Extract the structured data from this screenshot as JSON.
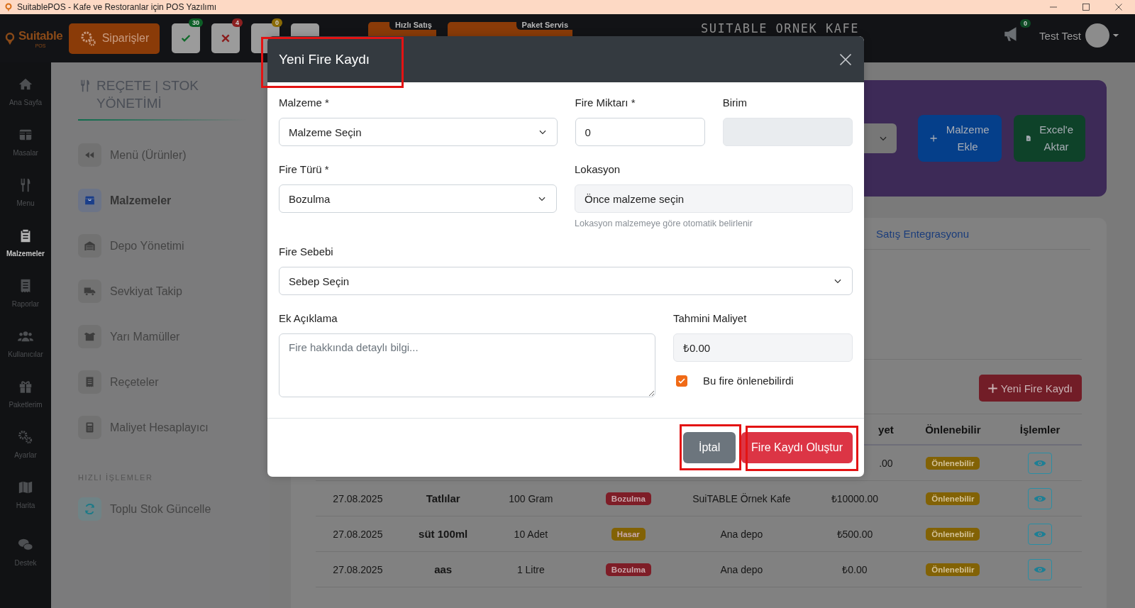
{
  "window": {
    "title": "SuitablePOS - Kafe ve Restoranlar için POS Yazılımı"
  },
  "top_bar": {
    "logo": "Suitable",
    "logo_sub": "POS",
    "orders_button": "Siparişler",
    "status_buttons": [
      {
        "kind": "check",
        "count": "30",
        "color": "#0d5f27"
      },
      {
        "kind": "cross",
        "count": "4",
        "color": "#8c2020"
      },
      {
        "kind": "blank",
        "count": "0",
        "color": "#8a6a05"
      },
      {
        "kind": "blank"
      }
    ],
    "quick_buttons": [
      {
        "label": "Hızlı Satış"
      },
      {
        "label": "Paket Servis"
      }
    ],
    "store_name": "SUITABLE ORNEK KAFE",
    "announcement_count": "0",
    "user": "Test Test"
  },
  "rail": [
    {
      "label": "Ana Sayfa",
      "selected": false
    },
    {
      "label": "Masalar",
      "selected": false
    },
    {
      "label": "Menu",
      "selected": false
    },
    {
      "label": "Malzemeler",
      "selected": true
    },
    {
      "label": "Raporlar",
      "selected": false
    },
    {
      "label": "Kullanıcılar",
      "selected": false
    },
    {
      "label": "Paketlerim",
      "selected": false
    },
    {
      "label": "Ayarlar",
      "selected": false
    },
    {
      "label": "Harita",
      "selected": false
    },
    {
      "label": "Destek",
      "selected": false
    }
  ],
  "stock_menu": {
    "title": "REÇETE | STOK YÖNETİMİ",
    "items": [
      {
        "label": "Menü (Ürünler)",
        "selected": false
      },
      {
        "label": "Malzemeler",
        "selected": true
      },
      {
        "label": "Depo Yönetimi",
        "selected": false
      },
      {
        "label": "Sevkiyat Takip",
        "selected": false
      },
      {
        "label": "Yarı Mamüller",
        "selected": false
      },
      {
        "label": "Reçeteler",
        "selected": false
      },
      {
        "label": "Maliyet Hesaplayıcı",
        "selected": false
      }
    ],
    "section_title": "HIZLI İŞLEMLER",
    "quick_actions": [
      {
        "label": "Toplu Stok Güncelle"
      }
    ]
  },
  "header_card": {
    "buttons": [
      {
        "kind": "add",
        "label": "Malzeme Ekle"
      },
      {
        "kind": "excel",
        "label": "Excel'e Aktar"
      }
    ]
  },
  "tabs": [
    {
      "label": "Satış Entegrasyonu"
    }
  ],
  "new_waste_button": "Yeni Fire Kaydı",
  "table": {
    "columns": [
      "yet",
      "Önlenebilir",
      "İşlemler"
    ],
    "rows": [
      {
        "cost": ".00",
        "preventable": "Önlenebilir"
      },
      {
        "date": "27.08.2025",
        "item": "Tatlılar",
        "quantity": "100 Gram",
        "type": {
          "label": "Bozulma",
          "color": "#7e1d27"
        },
        "location": "SuiTABLE Örnek Kafe",
        "cost": "₺10000.00",
        "preventable": "Önlenebilir"
      },
      {
        "date": "27.08.2025",
        "item": "süt 100ml",
        "quantity": "10 Adet",
        "type": {
          "label": "Hasar",
          "color": "#826205"
        },
        "location": "Ana depo",
        "cost": "₺500.00",
        "preventable": "Önlenebilir"
      },
      {
        "date": "27.08.2025",
        "item": "aas",
        "quantity": "1 Litre",
        "type": {
          "label": "Bozulma",
          "color": "#7e1d27"
        },
        "location": "Ana depo",
        "cost": "₺0.00",
        "preventable": "Önlenebilir"
      }
    ]
  },
  "modal": {
    "title": "Yeni Fire Kaydı",
    "rows": [
      [
        {
          "label": "Malzeme *",
          "kind": "select",
          "value": "Malzeme Seçin"
        },
        {
          "label": "Fire Miktarı *",
          "kind": "input",
          "value": "0"
        },
        {
          "label": "Birim",
          "kind": "readonly"
        }
      ],
      [
        {
          "label": "Fire Türü *",
          "kind": "select",
          "value": "Bozulma"
        },
        {
          "label": "Lokasyon",
          "kind": "readonly",
          "value": "Önce malzeme seçin",
          "help": "Lokasyon malzemeye göre otomatik belirlenir"
        }
      ],
      [
        {
          "label": "Fire Sebebi",
          "kind": "select",
          "value": "Sebep Seçin"
        }
      ],
      [
        {
          "label": "Ek Açıklama",
          "kind": "textarea",
          "placeholder": "Fire hakkında detaylı bilgi..."
        },
        {
          "label": "Tahmini Maliyet",
          "kind": "readonly",
          "value": "₺0.00",
          "checkbox": {
            "label": "Bu fire önlenebilirdi",
            "checked": true
          }
        }
      ]
    ],
    "buttons": [
      {
        "kind": "secondary",
        "label": "İptal"
      },
      {
        "kind": "danger",
        "label": "Fire Kaydı Oluştur"
      }
    ]
  }
}
